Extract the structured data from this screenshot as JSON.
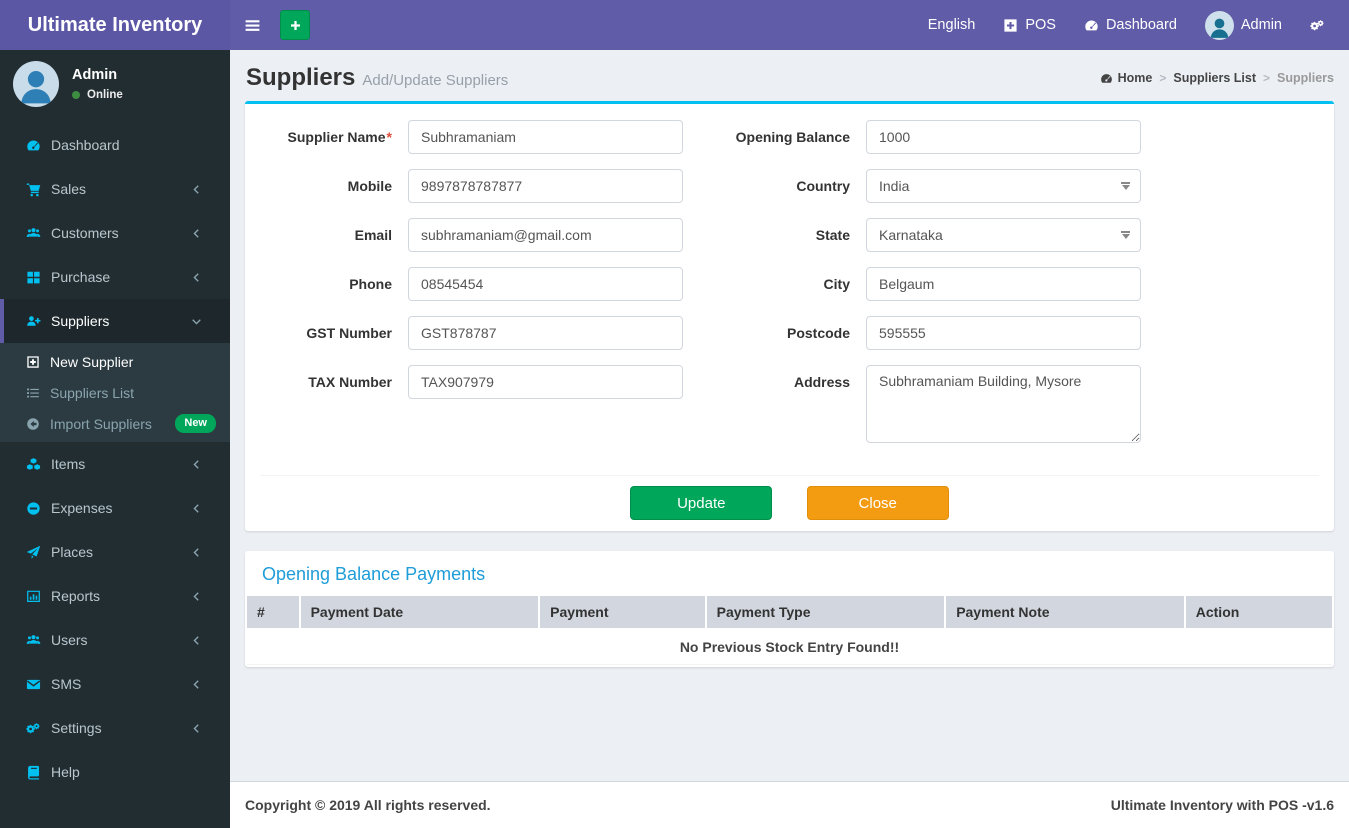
{
  "colors": {
    "navbar_purple": "#605ca8",
    "sidebar_dark": "#222d32",
    "sidebar_submenu": "#2c3b41",
    "icon_cyan": "#00c0ef",
    "box_top_border": "#00c0ef",
    "success_green": "#00a65a",
    "warning_orange": "#f39c12",
    "title_blue": "#1e9dd8",
    "table_header_bg": "#d2d6de",
    "content_bg": "#ecf0f5"
  },
  "navbar": {
    "brand": "Ultimate Inventory",
    "actions": [
      {
        "name": "sidebar-toggle",
        "icon": "bars-icon"
      },
      {
        "name": "quick-add",
        "icon": "plus-icon"
      }
    ],
    "items": [
      {
        "name": "language-menu",
        "label": "English"
      },
      {
        "name": "pos-link",
        "icon": "plus-square-icon",
        "label": "POS"
      },
      {
        "name": "dashboard-link",
        "icon": "tachometer-icon",
        "label": "Dashboard"
      },
      {
        "name": "user-menu",
        "icon": "user-avatar-icon",
        "label": "Admin"
      },
      {
        "name": "settings-menu",
        "icon": "cogs-icon",
        "label": ""
      }
    ]
  },
  "sidebar": {
    "user": {
      "name": "Admin",
      "status": "Online"
    },
    "items": [
      {
        "label": "Dashboard",
        "icon": "tachometer-icon"
      },
      {
        "label": "Sales",
        "icon": "cart-icon",
        "collapsible": true
      },
      {
        "label": "Customers",
        "icon": "users-icon",
        "collapsible": true
      },
      {
        "label": "Purchase",
        "icon": "th-large-icon",
        "collapsible": true
      },
      {
        "label": "Suppliers",
        "icon": "user-plus-icon",
        "collapsible": true,
        "expanded": true,
        "active": true,
        "children": [
          {
            "label": "New Supplier",
            "icon": "plus-square-o-icon",
            "active": true
          },
          {
            "label": "Suppliers List",
            "icon": "list-icon"
          },
          {
            "label": "Import Suppliers",
            "icon": "arrow-circle-left-icon",
            "badge": "New"
          }
        ]
      },
      {
        "label": "Items",
        "icon": "cubes-icon",
        "collapsible": true
      },
      {
        "label": "Expenses",
        "icon": "minus-circle-icon",
        "collapsible": true
      },
      {
        "label": "Places",
        "icon": "paper-plane-icon",
        "collapsible": true
      },
      {
        "label": "Reports",
        "icon": "bar-chart-icon",
        "collapsible": true
      },
      {
        "label": "Users",
        "icon": "users-icon",
        "collapsible": true
      },
      {
        "label": "SMS",
        "icon": "envelope-icon",
        "collapsible": true
      },
      {
        "label": "Settings",
        "icon": "cogs-icon",
        "collapsible": true
      },
      {
        "label": "Help",
        "icon": "book-icon"
      }
    ]
  },
  "page": {
    "title": "Suppliers",
    "subtitle": "Add/Update Suppliers",
    "breadcrumb": [
      {
        "label": "Home",
        "icon": "tachometer-icon"
      },
      {
        "label": "Suppliers List"
      },
      {
        "label": "Suppliers"
      }
    ]
  },
  "form": {
    "fields_left": [
      {
        "label": "Supplier Name",
        "required": true,
        "type": "text",
        "value": "Subhramaniam"
      },
      {
        "label": "Mobile",
        "type": "text",
        "value": "9897878787877"
      },
      {
        "label": "Email",
        "type": "text",
        "value": "subhramaniam@gmail.com"
      },
      {
        "label": "Phone",
        "type": "text",
        "value": "08545454"
      },
      {
        "label": "GST Number",
        "type": "text",
        "value": "GST878787"
      },
      {
        "label": "TAX Number",
        "type": "text",
        "value": "TAX907979"
      }
    ],
    "fields_right": [
      {
        "label": "Opening Balance",
        "type": "text",
        "value": "1000"
      },
      {
        "label": "Country",
        "type": "select",
        "value": "India"
      },
      {
        "label": "State",
        "type": "select",
        "value": "Karnataka"
      },
      {
        "label": "City",
        "type": "text",
        "value": "Belgaum"
      },
      {
        "label": "Postcode",
        "type": "text",
        "value": "595555"
      },
      {
        "label": "Address",
        "type": "textarea",
        "value": "Subhramaniam Building, Mysore"
      }
    ],
    "buttons": {
      "update": "Update",
      "close": "Close"
    }
  },
  "payments": {
    "title": "Opening Balance Payments",
    "columns": [
      "#",
      "Payment Date",
      "Payment",
      "Payment Type",
      "Payment Note",
      "Action"
    ],
    "empty_message": "No Previous Stock Entry Found!!"
  },
  "footer": {
    "left": "Copyright © 2019 All rights reserved.",
    "right": "Ultimate Inventory with POS -v1.6"
  }
}
